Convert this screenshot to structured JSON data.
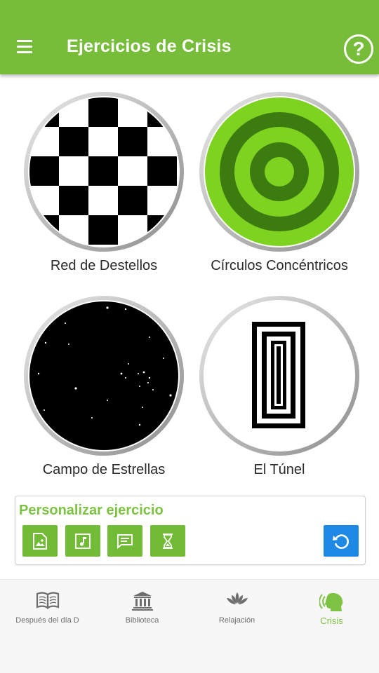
{
  "appbar": {
    "title": "Ejercicios de Crisis",
    "menu_icon": "menu-icon",
    "help_label": "?",
    "background_color": "#78bd3a"
  },
  "exercises": [
    {
      "label": "Red de Destellos",
      "icon": "checkerboard"
    },
    {
      "label": "Círculos Concéntricos",
      "icon": "concentric-circles"
    },
    {
      "label": "Campo de Estrellas",
      "icon": "starfield"
    },
    {
      "label": "El Túnel",
      "icon": "tunnel"
    }
  ],
  "customize": {
    "title": "Personalizar ejercicio",
    "options": [
      {
        "icon": "image-icon"
      },
      {
        "icon": "music-icon"
      },
      {
        "icon": "message-icon"
      },
      {
        "icon": "hourglass-icon"
      }
    ],
    "reset_icon": "reset-icon",
    "accent_color": "#7dc243",
    "reset_color": "#1e88e5"
  },
  "bottom_nav": {
    "active_index": 3,
    "items": [
      {
        "label": "Después del día D",
        "icon": "book-icon"
      },
      {
        "label": "Biblioteca",
        "icon": "library-icon"
      },
      {
        "label": "Relajación",
        "icon": "lotus-icon"
      },
      {
        "label": "Crisis",
        "icon": "crisis-head-icon"
      }
    ]
  }
}
